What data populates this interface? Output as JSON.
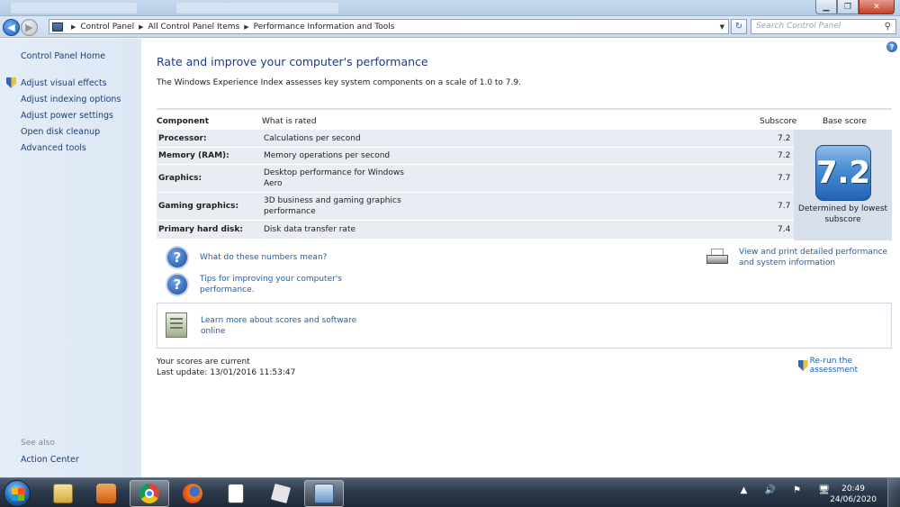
{
  "address_bar": {
    "crumbs": [
      "Control Panel",
      "All Control Panel Items",
      "Performance Information and Tools"
    ],
    "search_placeholder": "Search Control Panel"
  },
  "left_pane": {
    "home": "Control Panel Home",
    "items": [
      {
        "label": "Adjust visual effects",
        "shield": true
      },
      {
        "label": "Adjust indexing options",
        "shield": false
      },
      {
        "label": "Adjust power settings",
        "shield": false
      },
      {
        "label": "Open disk cleanup",
        "shield": false
      },
      {
        "label": "Advanced tools",
        "shield": false
      }
    ],
    "see_also": "See also",
    "action_center": "Action Center"
  },
  "main": {
    "title": "Rate and improve your computer's performance",
    "intro": "The Windows Experience Index assesses key system components on a scale of 1.0 to 7.9.",
    "headers": {
      "component": "Component",
      "what": "What is rated",
      "subscore": "Subscore",
      "base": "Base score"
    },
    "rows": [
      {
        "component": "Processor:",
        "what": "Calculations per second",
        "subscore": "7.2"
      },
      {
        "component": "Memory (RAM):",
        "what": "Memory operations per second",
        "subscore": "7.2"
      },
      {
        "component": "Graphics:",
        "what": "Desktop performance for Windows Aero",
        "subscore": "7.7"
      },
      {
        "component": "Gaming graphics:",
        "what": "3D business and gaming graphics performance",
        "subscore": "7.7"
      },
      {
        "component": "Primary hard disk:",
        "what": "Disk data transfer rate",
        "subscore": "7.4"
      }
    ],
    "base_score": "7.2",
    "determined": "Determined by lowest subscore",
    "links": {
      "numbers_meaning": "What do these numbers mean?",
      "tips": "Tips for improving your computer's performance.",
      "print": "View and print detailed performance and system information",
      "learn_more": "Learn more about scores and software online"
    },
    "status_current": "Your scores are current",
    "last_update": "Last update: 13/01/2016 11:53:47",
    "rerun": "Re-run the assessment"
  },
  "taskbar": {
    "apps": [
      "folder-icon",
      "media-player-icon",
      "chrome-icon",
      "firefox-icon",
      "notepad-icon",
      "roblox-icon",
      "control-panel-icon"
    ],
    "tray_icons": "▲ 🔊 ⚑ 🖥",
    "time": "20:49",
    "date": "24/06/2020"
  }
}
